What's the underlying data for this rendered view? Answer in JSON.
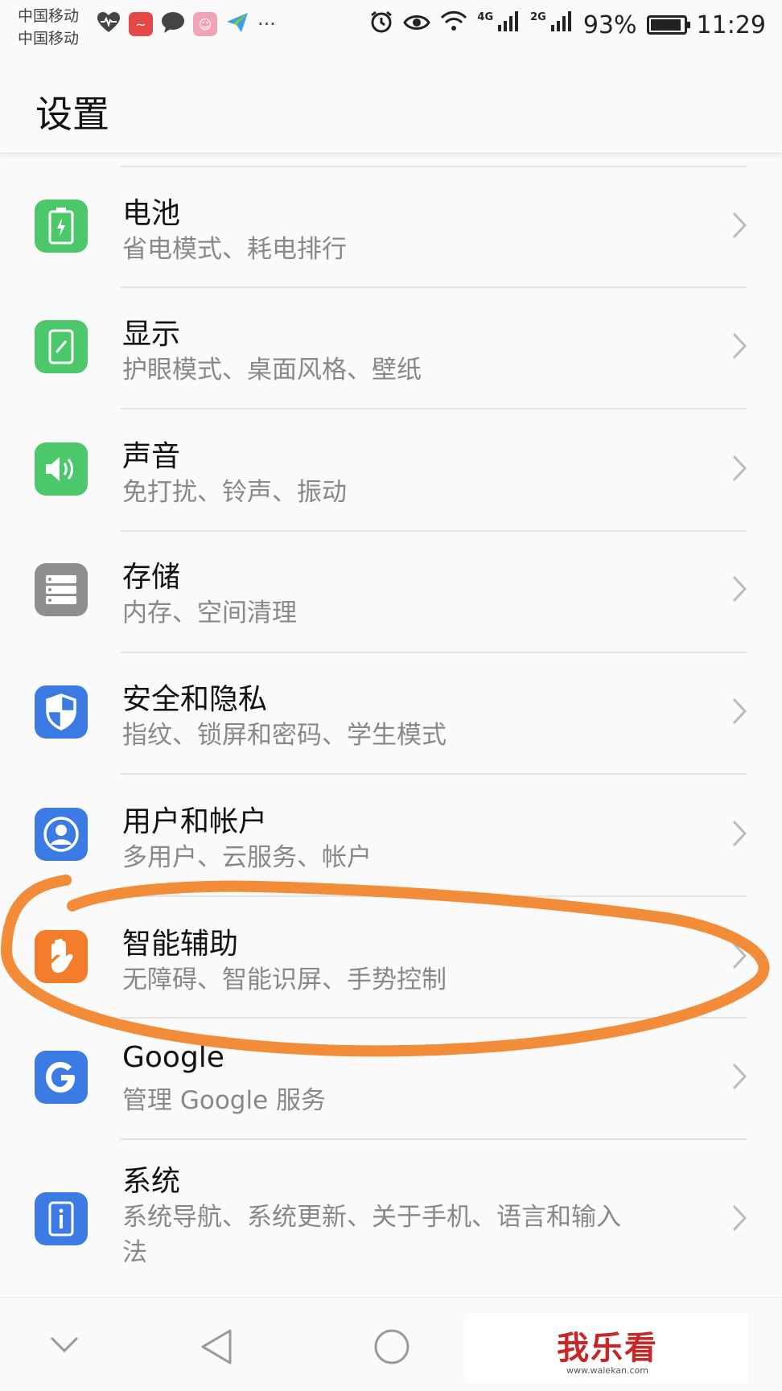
{
  "status_bar": {
    "carrier_1": "中国移动",
    "carrier_2": "中国移动",
    "network_1": "4G",
    "network_2": "2G",
    "battery_percent": "93%",
    "battery_level": 0.93,
    "time": "11:29",
    "more": "···"
  },
  "header": {
    "title": "设置"
  },
  "settings_items": [
    {
      "title": "电池",
      "subtitle": "省电模式、耗电排行",
      "icon": "battery-icon",
      "color": "#4cc76a"
    },
    {
      "title": "显示",
      "subtitle": "护眼模式、桌面风格、壁纸",
      "icon": "display-icon",
      "color": "#4cc76a"
    },
    {
      "title": "声音",
      "subtitle": "免打扰、铃声、振动",
      "icon": "sound-icon",
      "color": "#4cc76a"
    },
    {
      "title": "存储",
      "subtitle": "内存、空间清理",
      "icon": "storage-icon",
      "color": "#8e8e8e"
    },
    {
      "title": "安全和隐私",
      "subtitle": "指纹、锁屏和密码、学生模式",
      "icon": "shield-icon",
      "color": "#3c7be3"
    },
    {
      "title": "用户和帐户",
      "subtitle": "多用户、云服务、帐户",
      "icon": "user-icon",
      "color": "#3c7be3"
    },
    {
      "title": "智能辅助",
      "subtitle": "无障碍、智能识屏、手势控制",
      "icon": "hand-icon",
      "color": "#f37d2a"
    },
    {
      "title": "Google",
      "subtitle": "管理 Google 服务",
      "icon": "google-icon",
      "color": "#3c7be3"
    },
    {
      "title": "系统",
      "subtitle_line1": "系统导航、系统更新、关于手机、语言和输入",
      "subtitle_line2": "法",
      "icon": "info-icon",
      "color": "#3c7be3"
    }
  ],
  "watermark": {
    "main": "我乐看",
    "sub": "www.walekan.com"
  },
  "annotation_color": "#f28c38"
}
